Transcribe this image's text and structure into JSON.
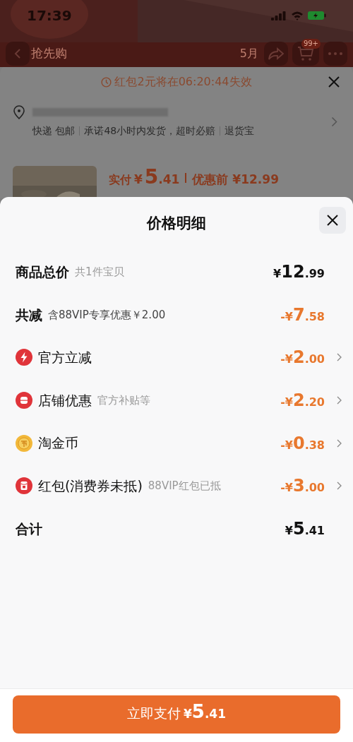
{
  "status_bar": {
    "time": "17:39"
  },
  "nav": {
    "title": "抢先购",
    "subtitle": "5月",
    "cart_badge": "99+"
  },
  "order_sheet": {
    "countdown": "红包2元将在06:20:44失效",
    "shipping": [
      "快递 包邮",
      "承诺48小时内发货，超时必赔",
      "退货宝"
    ],
    "price": {
      "label": "实付",
      "currency": "¥",
      "integer": "5",
      "decimals": ".41",
      "original": "优惠前 ¥12.99"
    }
  },
  "price_detail": {
    "title": "价格明细",
    "rows": [
      {
        "kind": "total",
        "label": "商品总价",
        "note": "共1件宝贝",
        "currency": "¥",
        "integer": "12",
        "decimals": ".99"
      },
      {
        "kind": "reduction",
        "label": "共减",
        "note": "含88VIP专享优惠￥2.00",
        "currency": "-¥",
        "integer": "7",
        "decimals": ".58"
      },
      {
        "kind": "official",
        "label": "官方立减",
        "currency": "-¥",
        "integer": "2",
        "decimals": ".00"
      },
      {
        "kind": "store",
        "label": "店铺优惠",
        "note": "官方补贴等",
        "currency": "-¥",
        "integer": "2",
        "decimals": ".20"
      },
      {
        "kind": "coin",
        "label": "淘金币",
        "currency": "-¥",
        "integer": "0",
        "decimals": ".38"
      },
      {
        "kind": "redpacket",
        "label": "红包(消费券未抵)",
        "note": "88VIP红包已抵",
        "currency": "-¥",
        "integer": "3",
        "decimals": ".00"
      },
      {
        "kind": "sum",
        "label": "合计",
        "currency": "¥",
        "integer": "5",
        "decimals": ".41"
      }
    ],
    "pay_button": {
      "label": "立即支付",
      "currency": "¥",
      "integer": "5",
      "decimals": ".41"
    }
  }
}
